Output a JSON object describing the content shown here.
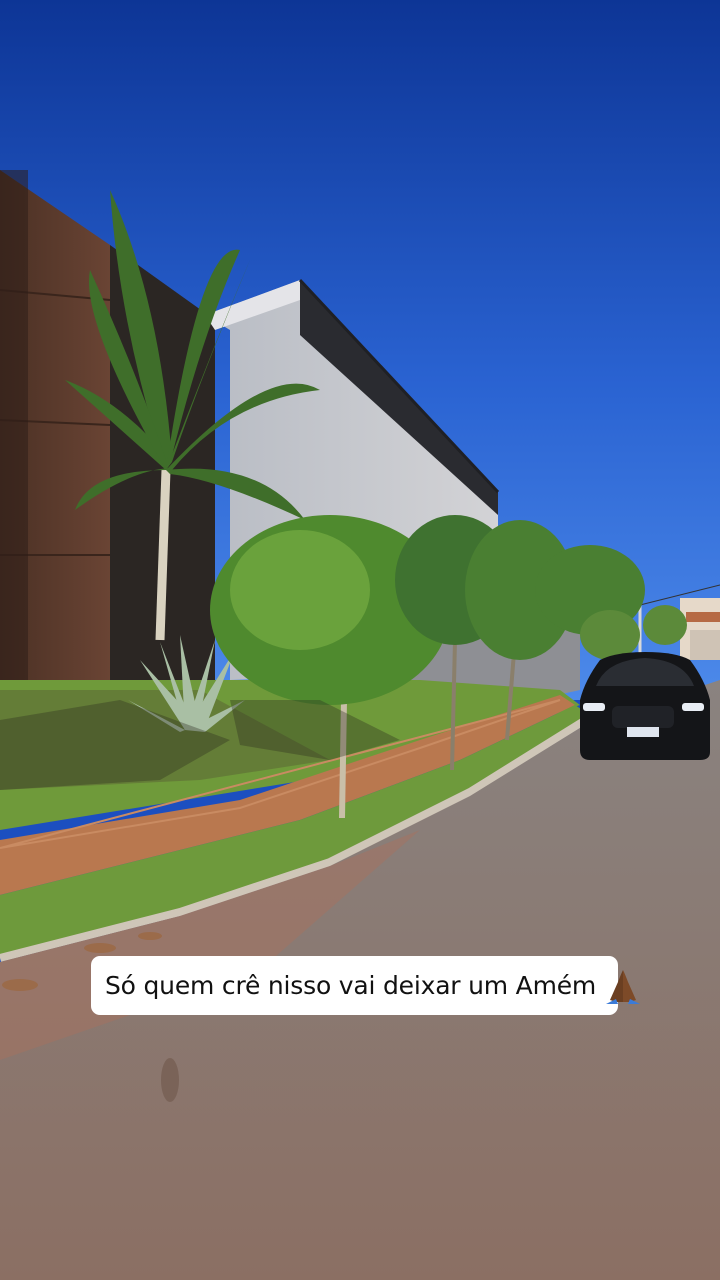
{
  "story": {
    "caption": "Só quem crê nisso vai deixar um Amém",
    "caption_emoji": "praying-hands-icon"
  },
  "colors": {
    "sky_top": "#0f3a9e",
    "sky_bottom": "#3a78e0",
    "road": "#8f7f78",
    "lawn": "#6f9a3a",
    "sidewalk": "#b9784f",
    "wall_dark": "#5a3b2c",
    "wall_light": "#c9c9cc",
    "car": "#141518",
    "caption_bg": "#ffffff"
  }
}
